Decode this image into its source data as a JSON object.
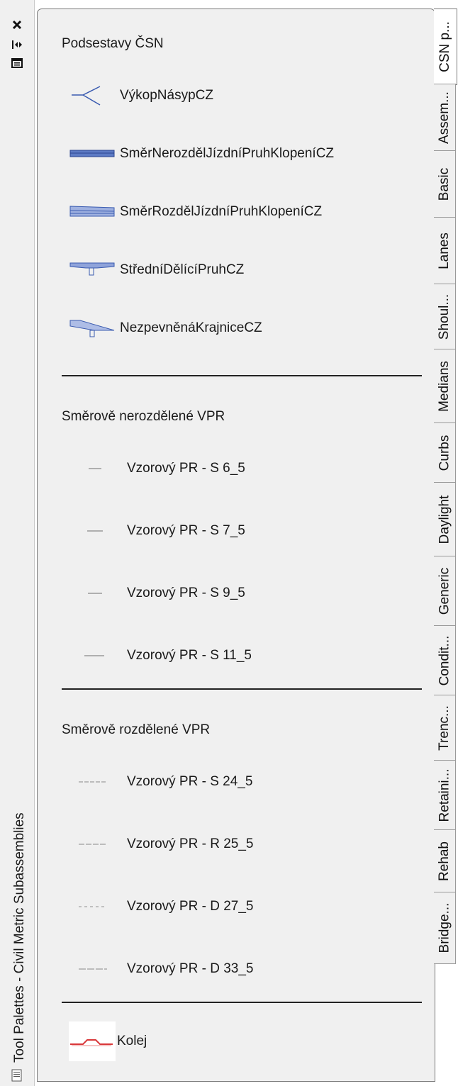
{
  "palette_title": "Tool Palettes - Civil Metric Subassemblies",
  "sections": [
    {
      "title": "Podsestavy ČSN",
      "items": [
        {
          "label": "VýkopNásypCZ",
          "icon": "daylight-slope-icon"
        },
        {
          "label": "SměrNerozdělJízdníPruhKlopeníCZ",
          "icon": "undivided-lane-icon"
        },
        {
          "label": "SměrRozdělJízdníPruhKlopeníCZ",
          "icon": "divided-lane-icon"
        },
        {
          "label": "StředníDělícíPruhCZ",
          "icon": "median-icon"
        },
        {
          "label": "NezpevněnáKrajniceCZ",
          "icon": "shoulder-icon"
        }
      ]
    },
    {
      "title": "Směrově nerozdělené VPR",
      "items": [
        {
          "label": "Vzorový PR - S 6_5",
          "icon": "assembly-preview-icon"
        },
        {
          "label": "Vzorový PR - S 7_5",
          "icon": "assembly-preview-icon"
        },
        {
          "label": "Vzorový PR - S 9_5",
          "icon": "assembly-preview-icon"
        },
        {
          "label": "Vzorový PR - S 11_5",
          "icon": "assembly-preview-icon"
        }
      ]
    },
    {
      "title": "Směrově rozdělené VPR",
      "items": [
        {
          "label": "Vzorový PR - S 24_5",
          "icon": "assembly-preview-icon"
        },
        {
          "label": "Vzorový PR - R 25_5",
          "icon": "assembly-preview-icon"
        },
        {
          "label": "Vzorový PR - D 27_5",
          "icon": "assembly-preview-icon"
        },
        {
          "label": "Vzorový PR - D 33_5",
          "icon": "assembly-preview-icon"
        }
      ]
    },
    {
      "title": "",
      "items": [
        {
          "label": "Kolej",
          "icon": "rail-track-icon"
        }
      ]
    }
  ],
  "tabs": [
    {
      "label": "CSN p...",
      "active": true
    },
    {
      "label": "Assem..."
    },
    {
      "label": "Basic"
    },
    {
      "label": "Lanes"
    },
    {
      "label": "Shoul..."
    },
    {
      "label": "Medians"
    },
    {
      "label": "Curbs"
    },
    {
      "label": "Daylight"
    },
    {
      "label": "Generic"
    },
    {
      "label": "Condit..."
    },
    {
      "label": "Trenc..."
    },
    {
      "label": "Retaini..."
    },
    {
      "label": "Rehab"
    },
    {
      "label": "Bridge..."
    }
  ],
  "colors": {
    "panel_bg": "#f0f0f0",
    "icon_blue": "#3a5bb0",
    "rail_red": "#d9383a"
  }
}
